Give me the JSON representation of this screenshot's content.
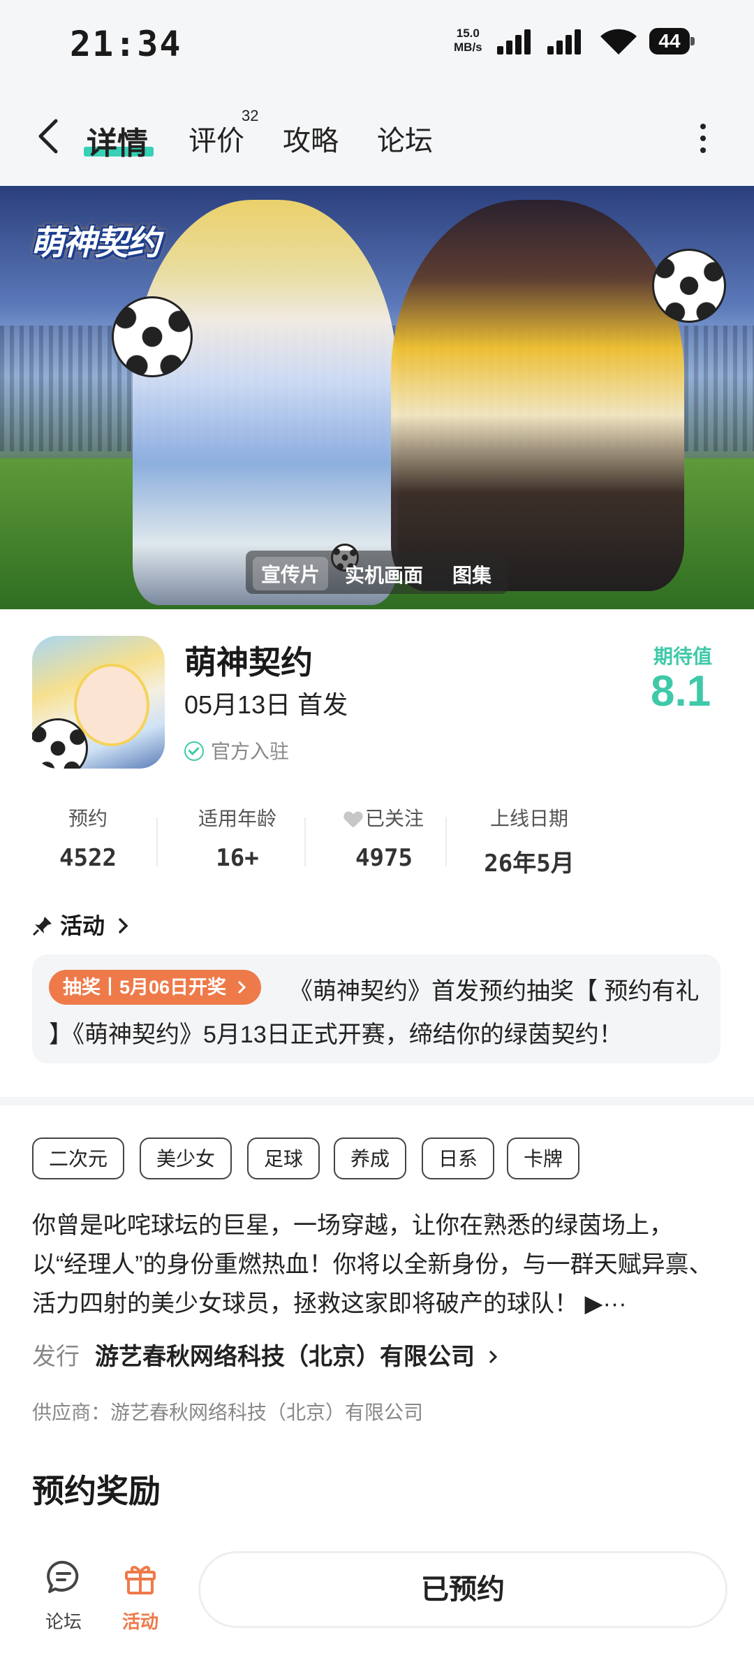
{
  "status_bar": {
    "time": "21:34",
    "net_speed_value": "15.0",
    "net_speed_unit": "MB/s",
    "battery": "44"
  },
  "nav": {
    "tabs": [
      {
        "label": "详情"
      },
      {
        "label": "评价",
        "count": "32"
      },
      {
        "label": "攻略"
      },
      {
        "label": "论坛"
      }
    ]
  },
  "banner": {
    "logo_text": "萌神契约",
    "media_tabs": [
      "宣传片",
      "实机画面",
      "图集"
    ]
  },
  "game": {
    "title": "萌神契约",
    "release": "05月13日 首发",
    "official": "官方入驻",
    "rating_label": "期待值",
    "rating_value": "8.1"
  },
  "stats": [
    {
      "label": "预约",
      "value": "4522"
    },
    {
      "label": "适用年龄",
      "value": "16+"
    },
    {
      "label": "已关注",
      "value": "4975"
    },
    {
      "label": "上线日期",
      "value": "26年5月"
    }
  ],
  "activity": {
    "heading": "活动",
    "badge": "抽奖丨5月06日开奖",
    "text": "《萌神契约》首发预约抽奖【 预约有礼 】《萌神契约》5月13日正式开赛，缔结你的绿茵契约！"
  },
  "tags": [
    "二次元",
    "美少女",
    "足球",
    "养成",
    "日系",
    "卡牌"
  ],
  "description": "你曾是叱咤球坛的巨星，一场穿越，让你在熟悉的绿茵场上，以“经理人”的身份重燃热血！你将以全新身份，与一群天赋异禀、活力四射的美少女球员，拯救这家即将破产的球队！ ▶···",
  "publisher": {
    "key": "发行",
    "value": "游艺春秋网络科技（北京）有限公司"
  },
  "supplier": "供应商：游艺春秋网络科技（北京）有限公司",
  "reward_title": "预约奖励",
  "bottom_bar": {
    "forum_label": "论坛",
    "activity_label": "活动",
    "reserve_label": "已预约"
  },
  "colors": {
    "accent": "#3fc9a9",
    "orange": "#ee7a4a"
  }
}
